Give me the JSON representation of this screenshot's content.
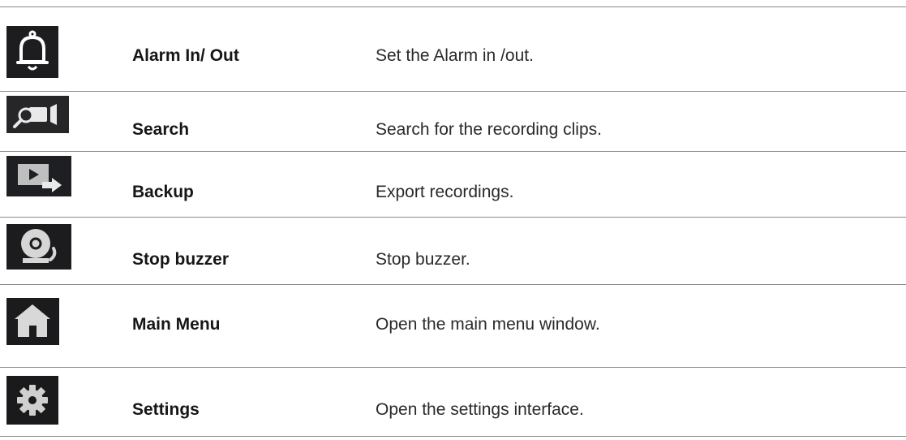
{
  "rows": [
    {
      "icon": "bell-icon",
      "name": "Alarm In/ Out",
      "description": "Set the Alarm in /out."
    },
    {
      "icon": "search-camera-icon",
      "name": "Search",
      "description": "Search for the recording clips."
    },
    {
      "icon": "backup-export-icon",
      "name": "Backup",
      "description": "Export recordings."
    },
    {
      "icon": "buzzer-icon",
      "name": "Stop buzzer",
      "description": "Stop buzzer."
    },
    {
      "icon": "home-icon",
      "name": "Main Menu",
      "description": "Open the main menu window."
    },
    {
      "icon": "gear-icon",
      "name": "Settings",
      "description": "Open the settings interface."
    }
  ]
}
